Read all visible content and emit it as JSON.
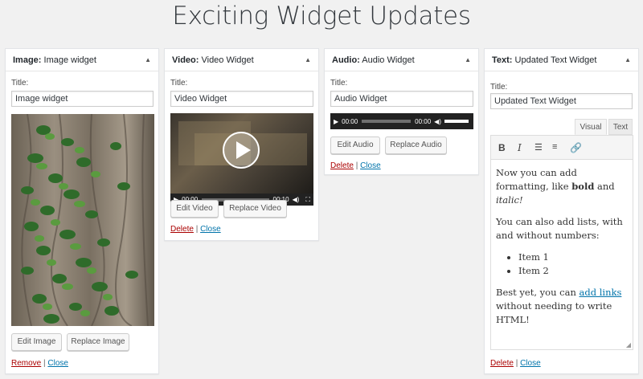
{
  "page_title": "Exciting Widget Updates",
  "widgets": {
    "image": {
      "type": "Image:",
      "name": "Image widget",
      "title_label": "Title:",
      "title_value": "Image widget",
      "edit_label": "Edit Image",
      "replace_label": "Replace Image",
      "remove_label": "Remove",
      "close_label": "Close"
    },
    "video": {
      "type": "Video:",
      "name": "Video Widget",
      "title_label": "Title:",
      "title_value": "Video Widget",
      "time_current": "00:00",
      "time_total": "00:10",
      "edit_label": "Edit Video",
      "replace_label": "Replace Video",
      "delete_label": "Delete",
      "close_label": "Close"
    },
    "audio": {
      "type": "Audio:",
      "name": "Audio Widget",
      "title_label": "Title:",
      "title_value": "Audio Widget",
      "time_current": "00:00",
      "time_total": "00:00",
      "edit_label": "Edit Audio",
      "replace_label": "Replace Audio",
      "delete_label": "Delete",
      "close_label": "Close"
    },
    "text": {
      "type": "Text:",
      "name": "Updated Text Widget",
      "title_label": "Title:",
      "title_value": "Updated Text Widget",
      "tab_visual": "Visual",
      "tab_text": "Text",
      "p1_a": "Now you can add formatting, like ",
      "p1_bold": "bold",
      "p1_and": " and ",
      "p1_italic": "italic!",
      "p2": "You can also add lists, with and without numbers:",
      "item1": "Item 1",
      "item2": "Item 2",
      "p3_a": "Best yet, you can ",
      "p3_link": "add links",
      "p3_b": " without needing to write HTML!",
      "delete_label": "Delete",
      "close_label": "Close"
    }
  },
  "separator": "|",
  "icons": {
    "toggle": "arrow-up",
    "bold": "B",
    "italic": "I",
    "bullet_list": "bullet-list",
    "number_list": "numbered-list",
    "link": "link"
  },
  "colors": {
    "background": "#f1f1f1",
    "delete": "#aa0000",
    "link": "#0073aa"
  }
}
